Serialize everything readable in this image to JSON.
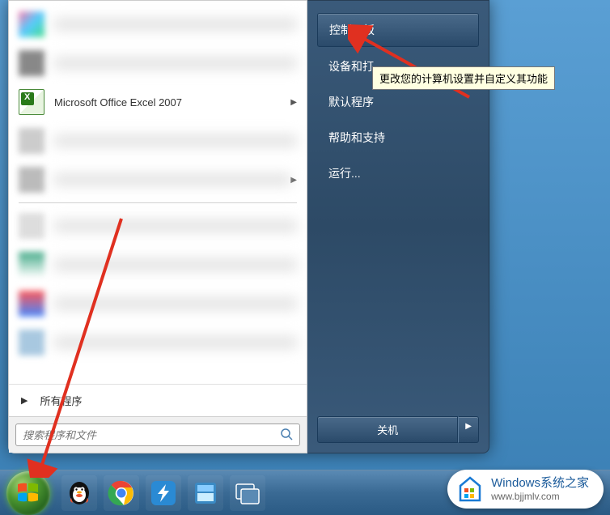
{
  "start_menu": {
    "programs": {
      "excel_label": "Microsoft Office Excel 2007",
      "all_programs_label": "所有程序"
    },
    "search": {
      "placeholder": "搜索程序和文件"
    },
    "right_items": {
      "control_panel": "控制面板",
      "devices": "设备和打",
      "default_programs": "默认程序",
      "help": "帮助和支持",
      "run": "运行..."
    },
    "shutdown_label": "关机",
    "tooltip_text": "更改您的计算机设置并自定义其功能"
  },
  "watermark": {
    "title": "Windows系统之家",
    "url": "www.bjjmlv.com"
  }
}
